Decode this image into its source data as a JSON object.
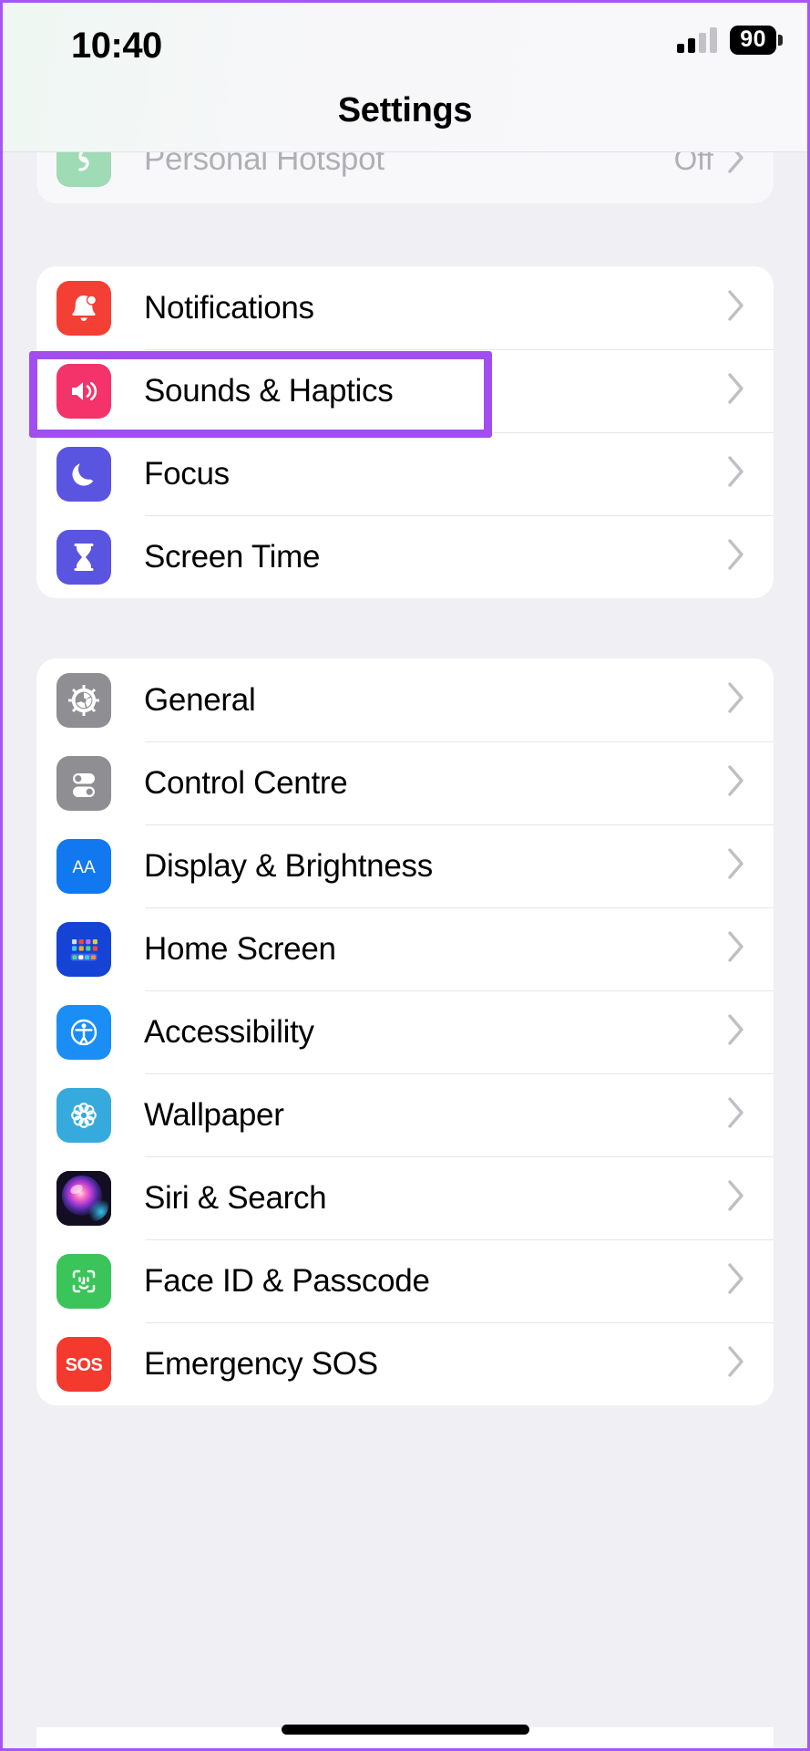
{
  "status_bar": {
    "time": "10:40",
    "signal_icon": "cellular-bars-icon",
    "battery_level": "90",
    "battery_icon": "battery-icon"
  },
  "header": {
    "title": "Settings"
  },
  "scrolled_row": {
    "label": "Personal Hotspot",
    "value": "Off",
    "icon": "hotspot-icon",
    "icon_color": "#6fd08f"
  },
  "groups": [
    {
      "id": "group-notifications",
      "rows": [
        {
          "label": "Notifications",
          "icon": "bell-icon",
          "icon_color": "#f43f35",
          "value": "",
          "highlighted": false
        },
        {
          "label": "Sounds & Haptics",
          "icon": "speaker-wave-icon",
          "icon_color": "#f4336a",
          "value": "",
          "highlighted": true
        },
        {
          "label": "Focus",
          "icon": "moon-icon",
          "icon_color": "#5a55e0",
          "value": "",
          "highlighted": false
        },
        {
          "label": "Screen Time",
          "icon": "hourglass-icon",
          "icon_color": "#5a55e0",
          "value": "",
          "highlighted": false
        }
      ]
    },
    {
      "id": "group-general",
      "rows": [
        {
          "label": "General",
          "icon": "gear-icon",
          "icon_color": "#8e8e93",
          "value": "",
          "highlighted": false
        },
        {
          "label": "Control Centre",
          "icon": "toggles-icon",
          "icon_color": "#8e8e93",
          "value": "",
          "highlighted": false
        },
        {
          "label": "Display & Brightness",
          "icon": "text-size-aa-icon",
          "icon_color": "#1178f0",
          "value": "",
          "highlighted": false
        },
        {
          "label": "Home Screen",
          "icon": "app-grid-icon",
          "icon_color": "#1543d6",
          "value": "",
          "highlighted": false
        },
        {
          "label": "Accessibility",
          "icon": "accessibility-icon",
          "icon_color": "#1a8ef5",
          "value": "",
          "highlighted": false
        },
        {
          "label": "Wallpaper",
          "icon": "flower-icon",
          "icon_color": "#36aadd",
          "value": "",
          "highlighted": false
        },
        {
          "label": "Siri & Search",
          "icon": "siri-orb-icon",
          "icon_color": "#2b2233",
          "value": "",
          "highlighted": false
        },
        {
          "label": "Face ID & Passcode",
          "icon": "face-id-icon",
          "icon_color": "#3ac45a",
          "value": "",
          "highlighted": false
        },
        {
          "label": "Emergency SOS",
          "icon": "sos-icon",
          "icon_color": "#f4392e",
          "value": "",
          "highlighted": false
        }
      ]
    }
  ],
  "annotation": {
    "target_label": "Sounds & Haptics",
    "color": "#a24df0"
  },
  "chevron_glyph": "›"
}
